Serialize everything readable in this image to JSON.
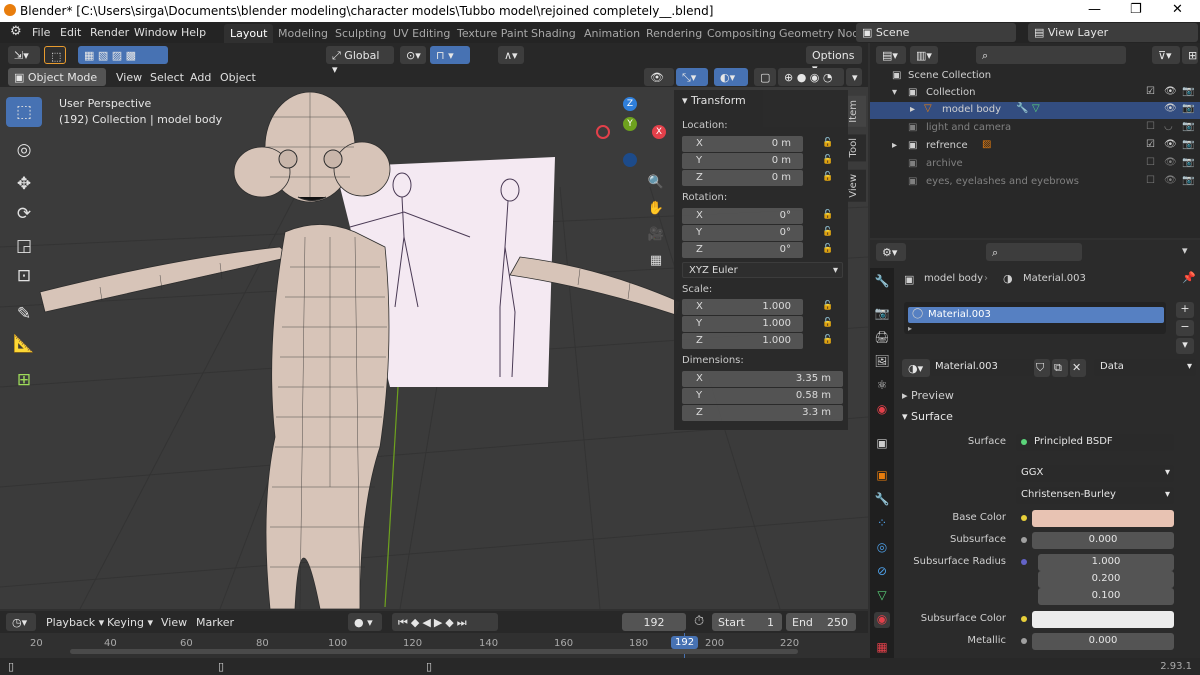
{
  "titlebar": {
    "text": "Blender* [C:\\Users\\sirga\\Documents\\blender modeling\\character models\\Tubbo model\\rejoined completely__.blend]",
    "minimize": "—",
    "maximize": "❐",
    "close": "✕"
  },
  "menus": [
    "File",
    "Edit",
    "Render",
    "Window",
    "Help"
  ],
  "workspaces": [
    "Layout",
    "Modeling",
    "Sculpting",
    "UV Editing",
    "Texture Paint",
    "Shading",
    "Animation",
    "Rendering",
    "Compositing",
    "Geometry Nod"
  ],
  "scene": "Scene",
  "view_layer": "View Layer",
  "viewport_header": {
    "transform_orientation": "Global",
    "options": "Options",
    "mode": "Object Mode",
    "menus": [
      "View",
      "Select",
      "Add",
      "Object"
    ]
  },
  "viewport": {
    "perspective": "User Perspective",
    "info": "(192) Collection | model body"
  },
  "gizmo": {
    "z": "Z",
    "x": "X",
    "y": "Y"
  },
  "npanel": {
    "tabs": [
      "Item",
      "Tool",
      "View"
    ],
    "title": "Transform",
    "location_label": "Location:",
    "location": [
      {
        "axis": "X",
        "value": "0 m"
      },
      {
        "axis": "Y",
        "value": "0 m"
      },
      {
        "axis": "Z",
        "value": "0 m"
      }
    ],
    "rotation_label": "Rotation:",
    "rotation": [
      {
        "axis": "X",
        "value": "0°"
      },
      {
        "axis": "Y",
        "value": "0°"
      },
      {
        "axis": "Z",
        "value": "0°"
      }
    ],
    "rotation_mode": "XYZ Euler",
    "scale_label": "Scale:",
    "scale": [
      {
        "axis": "X",
        "value": "1.000"
      },
      {
        "axis": "Y",
        "value": "1.000"
      },
      {
        "axis": "Z",
        "value": "1.000"
      }
    ],
    "dimensions_label": "Dimensions:",
    "dimensions": [
      {
        "axis": "X",
        "value": "3.35 m"
      },
      {
        "axis": "Y",
        "value": "0.58 m"
      },
      {
        "axis": "Z",
        "value": "3.3 m"
      }
    ]
  },
  "outliner": {
    "items": [
      {
        "label": "Scene Collection",
        "dim": false
      },
      {
        "label": "Collection",
        "dim": false
      },
      {
        "label": "model body",
        "dim": false
      },
      {
        "label": "light and camera",
        "dim": true
      },
      {
        "label": "refrence",
        "dim": false
      },
      {
        "label": "archive",
        "dim": true
      },
      {
        "label": "eyes, eyelashes and eyebrows",
        "dim": true
      }
    ]
  },
  "properties": {
    "breadcrumb_object": "model body",
    "breadcrumb_material": "Material.003",
    "slot": "Material.003",
    "material_name": "Material.003",
    "link": "Data",
    "preview": "Preview",
    "surface_section": "Surface",
    "surface_label": "Surface",
    "surface_value": "Principled BSDF",
    "distribution": "GGX",
    "subsurface_method": "Christensen-Burley",
    "base_color_label": "Base Color",
    "base_color": "#e8c3b3",
    "subsurface_label": "Subsurface",
    "subsurface": "0.000",
    "subsurface_radius_label": "Subsurface Radius",
    "subsurface_radius": [
      "1.000",
      "0.200",
      "0.100"
    ],
    "subsurface_color_label": "Subsurface Color",
    "subsurface_color": "#ececec",
    "metallic_label": "Metallic",
    "metallic": "0.000"
  },
  "timeline": {
    "menus": [
      "Playback",
      "Keying",
      "View",
      "Marker"
    ],
    "current_frame": "192",
    "start_label": "Start",
    "start": "1",
    "end_label": "End",
    "end": "250",
    "ticks": [
      "20",
      "40",
      "60",
      "80",
      "100",
      "120",
      "140",
      "160",
      "180",
      "192",
      "200",
      "220"
    ]
  },
  "status": {
    "version": "2.93.1"
  },
  "colors": {
    "accent": "#4772b3",
    "x_axis": "#e2404a",
    "y_axis": "#6ea21e",
    "z_axis": "#2f7fdb",
    "orange": "#e87d0d"
  }
}
